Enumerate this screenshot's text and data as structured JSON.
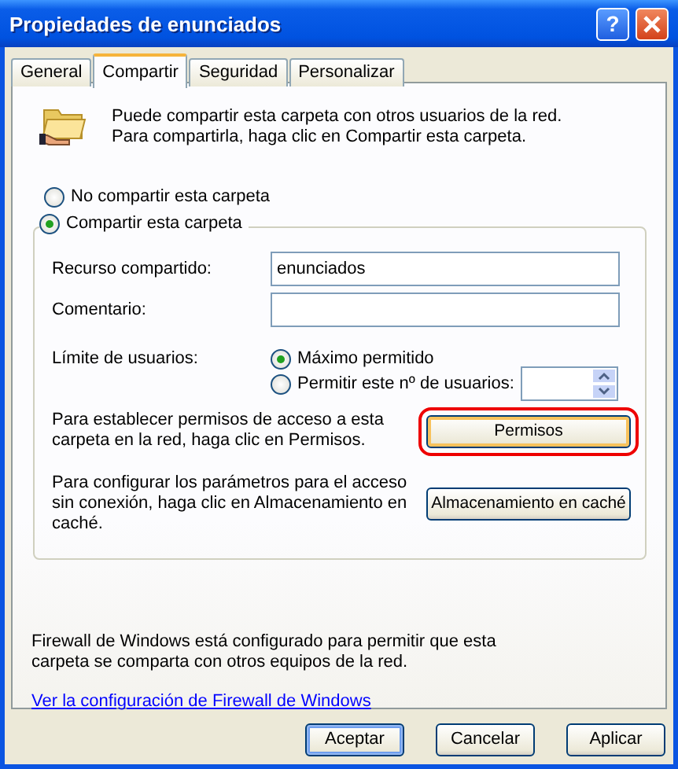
{
  "window": {
    "title": "Propiedades de enunciados",
    "help_button": "?"
  },
  "tabs": [
    {
      "label": "General",
      "selected": false
    },
    {
      "label": "Compartir",
      "selected": true
    },
    {
      "label": "Seguridad",
      "selected": false
    },
    {
      "label": "Personalizar",
      "selected": false
    }
  ],
  "intro": "Puede compartir esta carpeta con otros usuarios de la red. Para compartirla, haga clic en Compartir esta carpeta.",
  "share_options": [
    {
      "label": "No compartir esta carpeta",
      "selected": false
    },
    {
      "label": "Compartir esta carpeta",
      "selected": true
    }
  ],
  "fields": [
    {
      "label": "Recurso compartido:",
      "value": "enunciados"
    },
    {
      "label": "Comentario:"
    }
  ],
  "user_limit": {
    "label": "Límite de usuarios:",
    "options": [
      {
        "label": "Máximo permitido",
        "selected": true
      },
      {
        "label": "Permitir este nº de usuarios:",
        "selected": false
      }
    ]
  },
  "actions": [
    {
      "text": "Para establecer permisos de acceso a esta carpeta en la red, haga clic en Permisos.",
      "button": "Permisos",
      "highlighted": true
    },
    {
      "text": "Para configurar los parámetros para el acceso sin conexión, haga clic en Almacenamiento en caché.",
      "button": "Almacenamiento en caché",
      "highlighted": false
    }
  ],
  "firewall_note": "Firewall de Windows está configurado para permitir que esta carpeta se comparta con otros equipos de la red.",
  "firewall_link": "Ver la configuración de Firewall de Windows",
  "buttons": [
    {
      "label": "Aceptar",
      "default": true
    },
    {
      "label": "Cancelar",
      "default": false
    },
    {
      "label": "Aplicar",
      "default": false
    }
  ]
}
